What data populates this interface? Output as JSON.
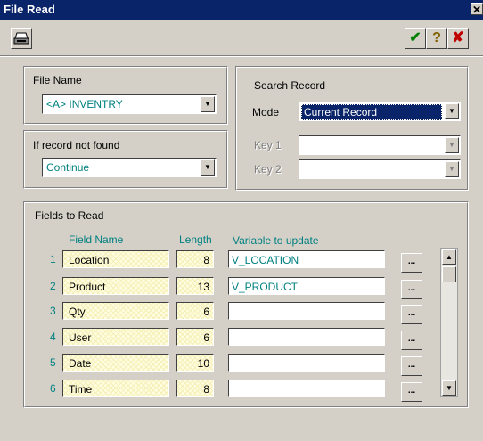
{
  "window": {
    "title": "File Read",
    "close_glyph": "✕"
  },
  "toolbar": {
    "print_icon": "print-icon",
    "ok_icon": "checkmark-icon",
    "help_icon": "question-icon",
    "cancel_icon": "x-icon",
    "help_glyph": "?",
    "cancel_glyph": "✘",
    "ok_glyph": "✔"
  },
  "file_name": {
    "label": "File Name",
    "value": "<A> INVENTRY"
  },
  "not_found": {
    "label": "If record not found",
    "value": "Continue"
  },
  "search": {
    "label": "Search Record",
    "mode_label": "Mode",
    "mode_value": "Current Record",
    "key1_label": "Key 1",
    "key2_label": "Key 2"
  },
  "fields": {
    "label": "Fields to Read",
    "col_field": "Field Name",
    "col_length": "Length",
    "col_var": "Variable to update",
    "dots_label": "...",
    "rows": [
      {
        "num": "1",
        "name": "Location",
        "length": "8",
        "var": "V_LOCATION"
      },
      {
        "num": "2",
        "name": "Product",
        "length": "13",
        "var": "V_PRODUCT"
      },
      {
        "num": "3",
        "name": "Qty",
        "length": "6",
        "var": ""
      },
      {
        "num": "4",
        "name": "User",
        "length": "6",
        "var": ""
      },
      {
        "num": "5",
        "name": "Date",
        "length": "10",
        "var": ""
      },
      {
        "num": "6",
        "name": "Time",
        "length": "8",
        "var": ""
      }
    ]
  },
  "colors": {
    "title_bar": "#0a246a",
    "teal_text": "#008080",
    "window_bg": "#d4d0c8"
  }
}
